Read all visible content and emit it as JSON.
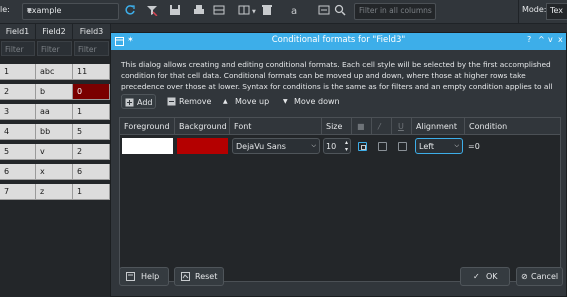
{
  "toolbar": {
    "table_label": "le:",
    "table_value": "example",
    "filter_all_placeholder": "Filter in all columns",
    "mode_label": "Mode:",
    "mode_value": "Tex"
  },
  "grid": {
    "columns": [
      "Field1",
      "Field2",
      "Field3"
    ],
    "filter_placeholder": "Filter",
    "rows": [
      [
        "1",
        "abc",
        "11"
      ],
      [
        "2",
        "b",
        "0"
      ],
      [
        "3",
        "aa",
        "1"
      ],
      [
        "4",
        "bb",
        "5"
      ],
      [
        "5",
        "v",
        "2"
      ],
      [
        "6",
        "x",
        "6"
      ],
      [
        "7",
        "z",
        "1"
      ]
    ],
    "highlight_color": "#7a0000"
  },
  "dialog": {
    "title": "Conditional formats for \"Field3\"",
    "title_controls": [
      "?",
      "^",
      "v",
      "x"
    ],
    "description": "This dialog allows creating and editing conditional formats. Each cell style will be selected by the first accomplished condition for that cell data. Conditional formats can be moved up and down, where those at higher rows take precedence over those at lower. Syntax for conditions is the same as for filters and an empty condition applies to all values.",
    "add_label": "Add",
    "remove_label": "Remove",
    "move_up_label": "Move up",
    "move_down_label": "Move down",
    "columns": [
      "Foreground",
      "Background",
      "Font",
      "Size",
      "",
      "",
      "",
      "Alignment",
      "Condition"
    ],
    "rule": {
      "foreground": "#ffffff",
      "background": "#b40000",
      "font": "DejaVu Sans",
      "size": "10",
      "alignment": "Left",
      "condition": "=0"
    },
    "help_label": "Help",
    "reset_label": "Reset",
    "ok_label": "OK",
    "cancel_label": "Cancel",
    "accent": "#3daee9"
  }
}
